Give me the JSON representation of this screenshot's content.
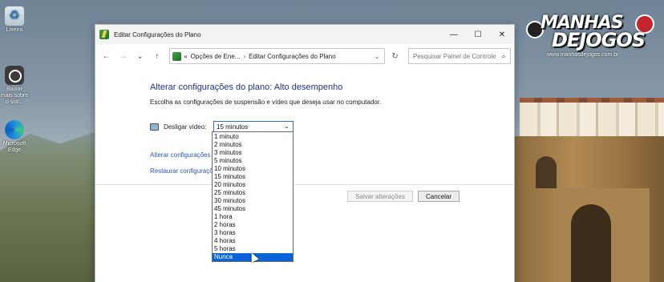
{
  "desktop": {
    "icons": [
      {
        "label": "Lixeira"
      },
      {
        "label": "Baixar mais sobre o sist..."
      },
      {
        "label": "Microsoft Edge"
      }
    ],
    "logo": {
      "line1": "MANHAS",
      "line2": "DEJOGOS",
      "url": "www.manhasdejogos.com.br"
    }
  },
  "window": {
    "title": "Editar Configurações do Plano",
    "controls": {
      "minimize": "—",
      "maximize": "☐",
      "close": "✕"
    },
    "nav": {
      "back": "←",
      "forward": "→",
      "recent": "⌄",
      "up": "↑"
    },
    "address": {
      "prefix": "«",
      "crumb1": "Opções de Ene...",
      "separator": "›",
      "crumb2": "Editar Configurações do Plano",
      "dropdown": "⌄",
      "refresh": "↻"
    },
    "search": {
      "placeholder": "Pesquisar Painel de Controle",
      "icon": "⌕"
    }
  },
  "main": {
    "heading": "Alterar configurações do plano: Alto desempenho",
    "subtitle": "Escolha as configurações de suspensão e vídeo que deseja usar no computador.",
    "display_off": {
      "label": "Desligar vídeo:",
      "value": "15 minutos",
      "chevron": "⌄"
    },
    "links": {
      "advanced": "Alterar configurações",
      "restore": "Restaurar configuraçõ"
    },
    "buttons": {
      "save": "Salvar alterações",
      "cancel": "Cancelar"
    }
  },
  "dropdown": {
    "options": [
      "1 minuto",
      "2 minutos",
      "3 minutos",
      "5 minutos",
      "10 minutos",
      "15 minutos",
      "20 minutos",
      "25 minutos",
      "30 minutos",
      "45 minutos",
      "1 hora",
      "2 horas",
      "3 horas",
      "4 horas",
      "5 horas",
      "Nunca"
    ],
    "highlighted": "Nunca"
  }
}
